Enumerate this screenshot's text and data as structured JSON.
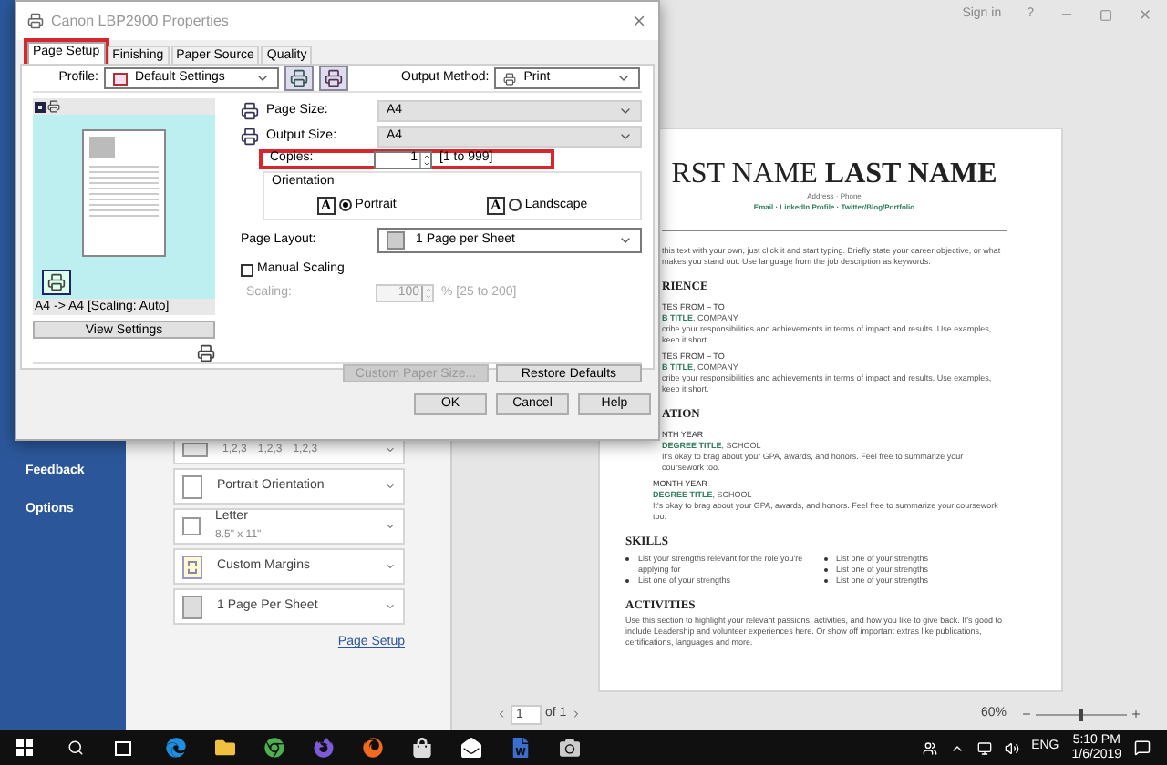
{
  "word": {
    "nav": [
      "Feedback",
      "Options"
    ],
    "settings": [
      {
        "kind": "collate",
        "parts": [
          "1,2,3",
          "1,2,3",
          "1,2,3"
        ]
      },
      {
        "kind": "orientation",
        "title": "Portrait Orientation"
      },
      {
        "kind": "paper",
        "title": "Letter",
        "subtitle": "8.5\" x 11\""
      },
      {
        "kind": "margins",
        "title": "Custom Margins"
      },
      {
        "kind": "pages",
        "title": "1 Page Per Sheet"
      }
    ],
    "page_setup_link": "Page Setup",
    "sign_in": "Sign in",
    "help": "?",
    "page_number": "1",
    "page_count": "of 1",
    "zoom": "60%",
    "zoom_slider": {
      "level": 0.5
    }
  },
  "document": {
    "name_first": "RST NAME",
    "name_last": "LAST NAME",
    "contact": "Address · Phone",
    "links": "Email · LinkedIn Profile · Twitter/Blog/Portfolio",
    "objective": "this text with your own, just click it and start typing. Briefly state your career objective, or what makes you stand out. Use language from the job description as keywords.",
    "sections": [
      {
        "heading": "RIENCE",
        "entries": [
          {
            "date": "TES FROM – TO",
            "title": "B TITLE",
            "org": ", COMPANY",
            "text": "cribe your responsibilities and achievements in terms of impact and results. Use examples, keep it short."
          },
          {
            "date": "TES FROM – TO",
            "title": "B TITLE",
            "org": ", COMPANY",
            "text": "cribe your responsibilities and achievements in terms of impact and results. Use examples, keep it short."
          }
        ]
      },
      {
        "heading": "ATION",
        "entries": [
          {
            "date": "NTH YEAR",
            "title": "DEGREE TITLE",
            "org": ", SCHOOL",
            "text": "It's okay to brag about your GPA, awards, and honors. Feel free to summarize your coursework too."
          },
          {
            "date": "MONTH YEAR",
            "title": "DEGREE TITLE",
            "org": ", SCHOOL",
            "text": "It's okay to brag about your GPA, awards, and honors. Feel free to summarize your coursework too."
          }
        ]
      },
      {
        "heading": "SKILLS",
        "bullet_columns": [
          [
            "List your strengths relevant for the role you're applying for",
            "List one of your strengths"
          ],
          [
            "List one of your strengths",
            "List one of your strengths",
            "List one of your strengths"
          ]
        ]
      },
      {
        "heading": "ACTIVITIES",
        "text": "Use this section to highlight your relevant passions, activities, and how you like to give back. It's good to include Leadership and volunteer experiences here. Or show off important extras like publications, certifications, languages and more."
      }
    ]
  },
  "dialog": {
    "title": "Canon LBP2900 Properties",
    "tabs": [
      {
        "label": "Page Setup",
        "selected": true,
        "highlighted": true
      },
      {
        "label": "Finishing",
        "selected": false,
        "highlighted": false
      },
      {
        "label": "Paper Source",
        "selected": false,
        "highlighted": false
      },
      {
        "label": "Quality",
        "selected": false,
        "highlighted": false
      }
    ],
    "profile": {
      "label": "Profile:",
      "value": "Default Settings"
    },
    "output_method": {
      "label": "Output Method:",
      "value": "Print"
    },
    "preview": {
      "caption": "A4 -> A4 [Scaling: Auto]",
      "button": "View Settings"
    },
    "page_size": {
      "label": "Page Size:",
      "value": "A4"
    },
    "output_size": {
      "label": "Output Size:",
      "value": "A4"
    },
    "copies": {
      "label": "Copies:",
      "value": "1",
      "range": "[1 to 999]",
      "highlighted": true
    },
    "orientation": {
      "label": "Orientation",
      "options": [
        {
          "label": "Portrait",
          "icon_letter": "A",
          "selected": true
        },
        {
          "label": "Landscape",
          "icon_letter": "A",
          "selected": false
        }
      ]
    },
    "page_layout": {
      "label": "Page Layout:",
      "value": "1 Page per Sheet"
    },
    "manual_scaling": {
      "label": "Manual Scaling",
      "checked": false
    },
    "scaling": {
      "label": "Scaling:",
      "value": "100",
      "range": "% [25 to 200]",
      "disabled": true
    },
    "buttons": [
      {
        "label": "Custom Paper Size...",
        "disabled": true
      },
      {
        "label": "Restore Defaults",
        "disabled": false
      }
    ],
    "footer_buttons": [
      "OK",
      "Cancel",
      "Help"
    ]
  },
  "taskbar": {
    "language": "ENG",
    "time": "5:10 PM",
    "date": "1/6/2019"
  }
}
